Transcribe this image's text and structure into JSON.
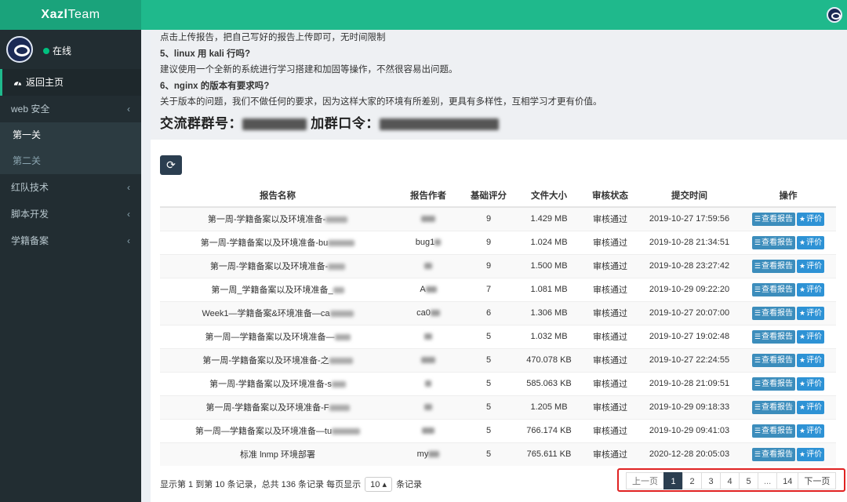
{
  "brand": {
    "name_bold": "Xazl",
    "name_thin": "Team"
  },
  "user": {
    "status": "在线"
  },
  "sidebar": {
    "home": "返回主页",
    "web_security": "web 安全",
    "sub": [
      "第一关",
      "第二关"
    ],
    "items": [
      "红队技术",
      "脚本开发",
      "学籍备案"
    ]
  },
  "notice": {
    "line1": "点击上传报告，把自己写好的报告上传即可，无时间限制",
    "q5": "5、linux 用 kali 行吗?",
    "a5": "建议使用一个全新的系统进行学习搭建和加固等操作，不然很容易出问题。",
    "q6": "6、nginx 的版本有要求吗?",
    "a6": "关于版本的问题，我们不做任何的要求，因为这样大家的环境有所差别，更具有多样性，互相学习才更有价值。",
    "group_label": "交流群群号：",
    "password_label": "加群口令："
  },
  "table": {
    "headers": [
      "报告名称",
      "报告作者",
      "基础评分",
      "文件大小",
      "审核状态",
      "提交时间",
      "操作"
    ],
    "view_label": "查看报告",
    "rate_label": "评价",
    "rows": [
      {
        "name": "第一周-学籍备案以及环境准备-",
        "author": "",
        "score": "9",
        "size": "1.429 MB",
        "status": "审核通过",
        "time": "2019-10-27 17:59:56"
      },
      {
        "name": "第一周-学籍备案以及环境准备-bu",
        "author": "bug1",
        "score": "9",
        "size": "1.024 MB",
        "status": "审核通过",
        "time": "2019-10-28 21:34:51"
      },
      {
        "name": "第一周-学籍备案以及环境准备-",
        "author": "",
        "score": "9",
        "size": "1.500 MB",
        "status": "审核通过",
        "time": "2019-10-28 23:27:42"
      },
      {
        "name": "第一周_学籍备案以及环境准备_",
        "author": "A",
        "score": "7",
        "size": "1.081 MB",
        "status": "审核通过",
        "time": "2019-10-29 09:22:20"
      },
      {
        "name": "Week1—学籍备案&环境准备—ca",
        "author": "ca0",
        "score": "6",
        "size": "1.306 MB",
        "status": "审核通过",
        "time": "2019-10-27 20:07:00"
      },
      {
        "name": "第一周—学籍备案以及环境准备—",
        "author": "",
        "score": "5",
        "size": "1.032 MB",
        "status": "审核通过",
        "time": "2019-10-27 19:02:48"
      },
      {
        "name": "第一周-学籍备案以及环境准备-之",
        "author": "",
        "score": "5",
        "size": "470.078 KB",
        "status": "审核通过",
        "time": "2019-10-27 22:24:55"
      },
      {
        "name": "第一周-学籍备案以及环境准备-s",
        "author": "",
        "score": "5",
        "size": "585.063 KB",
        "status": "审核通过",
        "time": "2019-10-28 21:09:51"
      },
      {
        "name": "第一周-学籍备案以及环境准备-F",
        "author": "",
        "score": "5",
        "size": "1.205 MB",
        "status": "审核通过",
        "time": "2019-10-29 09:18:33"
      },
      {
        "name": "第一周—学籍备案以及环境准备—tu",
        "author": "",
        "score": "5",
        "size": "766.174 KB",
        "status": "审核通过",
        "time": "2019-10-29 09:41:03"
      },
      {
        "name": "标准 lnmp 环境部署",
        "author": "my",
        "score": "5",
        "size": "765.611 KB",
        "status": "审核通过",
        "time": "2020-12-28 20:05:03"
      }
    ]
  },
  "footer": {
    "info": "显示第 1 到第 10 条记录，总共 136 条记录 每页显示",
    "page_size": "10",
    "records": "条记录"
  },
  "pagination": {
    "prev": "上一页",
    "pages": [
      "1",
      "2",
      "3",
      "4",
      "5",
      "...",
      "14"
    ],
    "next": "下一页"
  }
}
